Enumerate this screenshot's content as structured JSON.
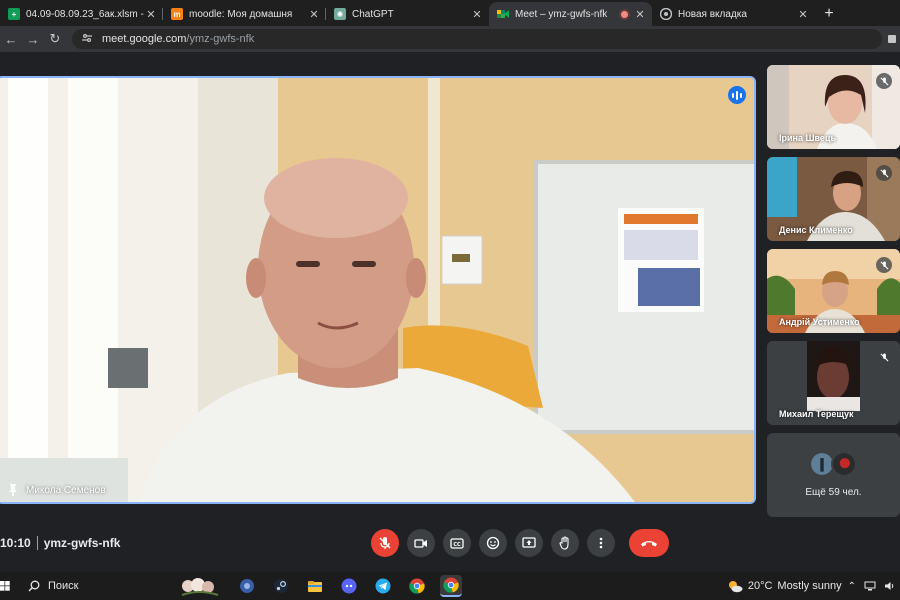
{
  "browser": {
    "tabs": [
      {
        "title": "04.09-08.09.23_6ак.xlsm - Googl",
        "favicon": "sheets-icon",
        "color": "#0f9d58",
        "active": false
      },
      {
        "title": "moodle: Моя домашня",
        "favicon": "moodle-icon",
        "color": "#f98012",
        "active": false
      },
      {
        "title": "ChatGPT",
        "favicon": "chatgpt-icon",
        "color": "#74aa9c",
        "active": false
      },
      {
        "title": "Meet – ymz-gwfs-nfk",
        "favicon": "meet-icon",
        "color": "#00897b",
        "active": true
      },
      {
        "title": "Новая вкладка",
        "favicon": "chrome-icon",
        "color": "#9aa0a6",
        "active": false
      }
    ],
    "new_tab": "+",
    "url_host": "meet.google.com",
    "url_path": "/ymz-gwfs-nfk"
  },
  "meet": {
    "main_participant": "Микола Семенов",
    "participants": [
      {
        "name": "Ірина Швець",
        "muted": true
      },
      {
        "name": "Денис Клименко",
        "muted": true
      },
      {
        "name": "Андрій Устименко",
        "muted": true
      },
      {
        "name": "Михаил Терещук",
        "muted": true
      }
    ],
    "others_label": "Ещё 59 чел.",
    "time": "10:10",
    "meeting_code": "ymz-gwfs-nfk",
    "accent": "#8ab4f8",
    "danger": "#ea4335"
  },
  "taskbar": {
    "search_label": "Поиск",
    "weather_temp": "20°C",
    "weather_text": "Mostly sunny"
  }
}
